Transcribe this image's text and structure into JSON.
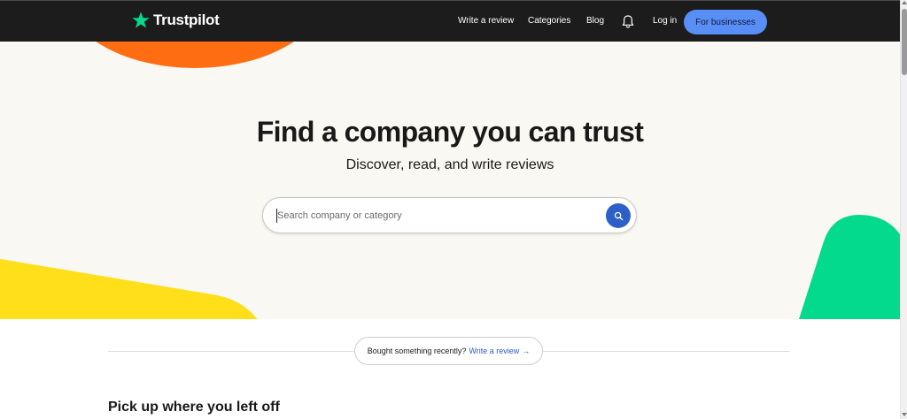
{
  "header": {
    "brand": "Trustpilot",
    "nav": {
      "write_review": "Write a review",
      "categories": "Categories",
      "blog": "Blog",
      "login": "Log in"
    },
    "business_button": "For businesses",
    "icons": {
      "logo": "star-icon",
      "notifications": "bell-icon"
    }
  },
  "hero": {
    "title": "Find a company you can trust",
    "subtitle": "Discover, read, and write reviews",
    "search": {
      "placeholder": "Search company or category",
      "value": ""
    }
  },
  "recent": {
    "prompt": "Bought something recently?",
    "link": "Write a review",
    "arrow": "→"
  },
  "section_title": "Pick up where you left off",
  "colors": {
    "header_bg": "#1c1c1c",
    "accent_blue": "#5a8ef7",
    "search_button": "#2d5fc9",
    "brand_green": "#04da8d",
    "orange": "#ff6d12",
    "yellow": "#ffdf1a",
    "hero_bg": "#faf8f3"
  }
}
